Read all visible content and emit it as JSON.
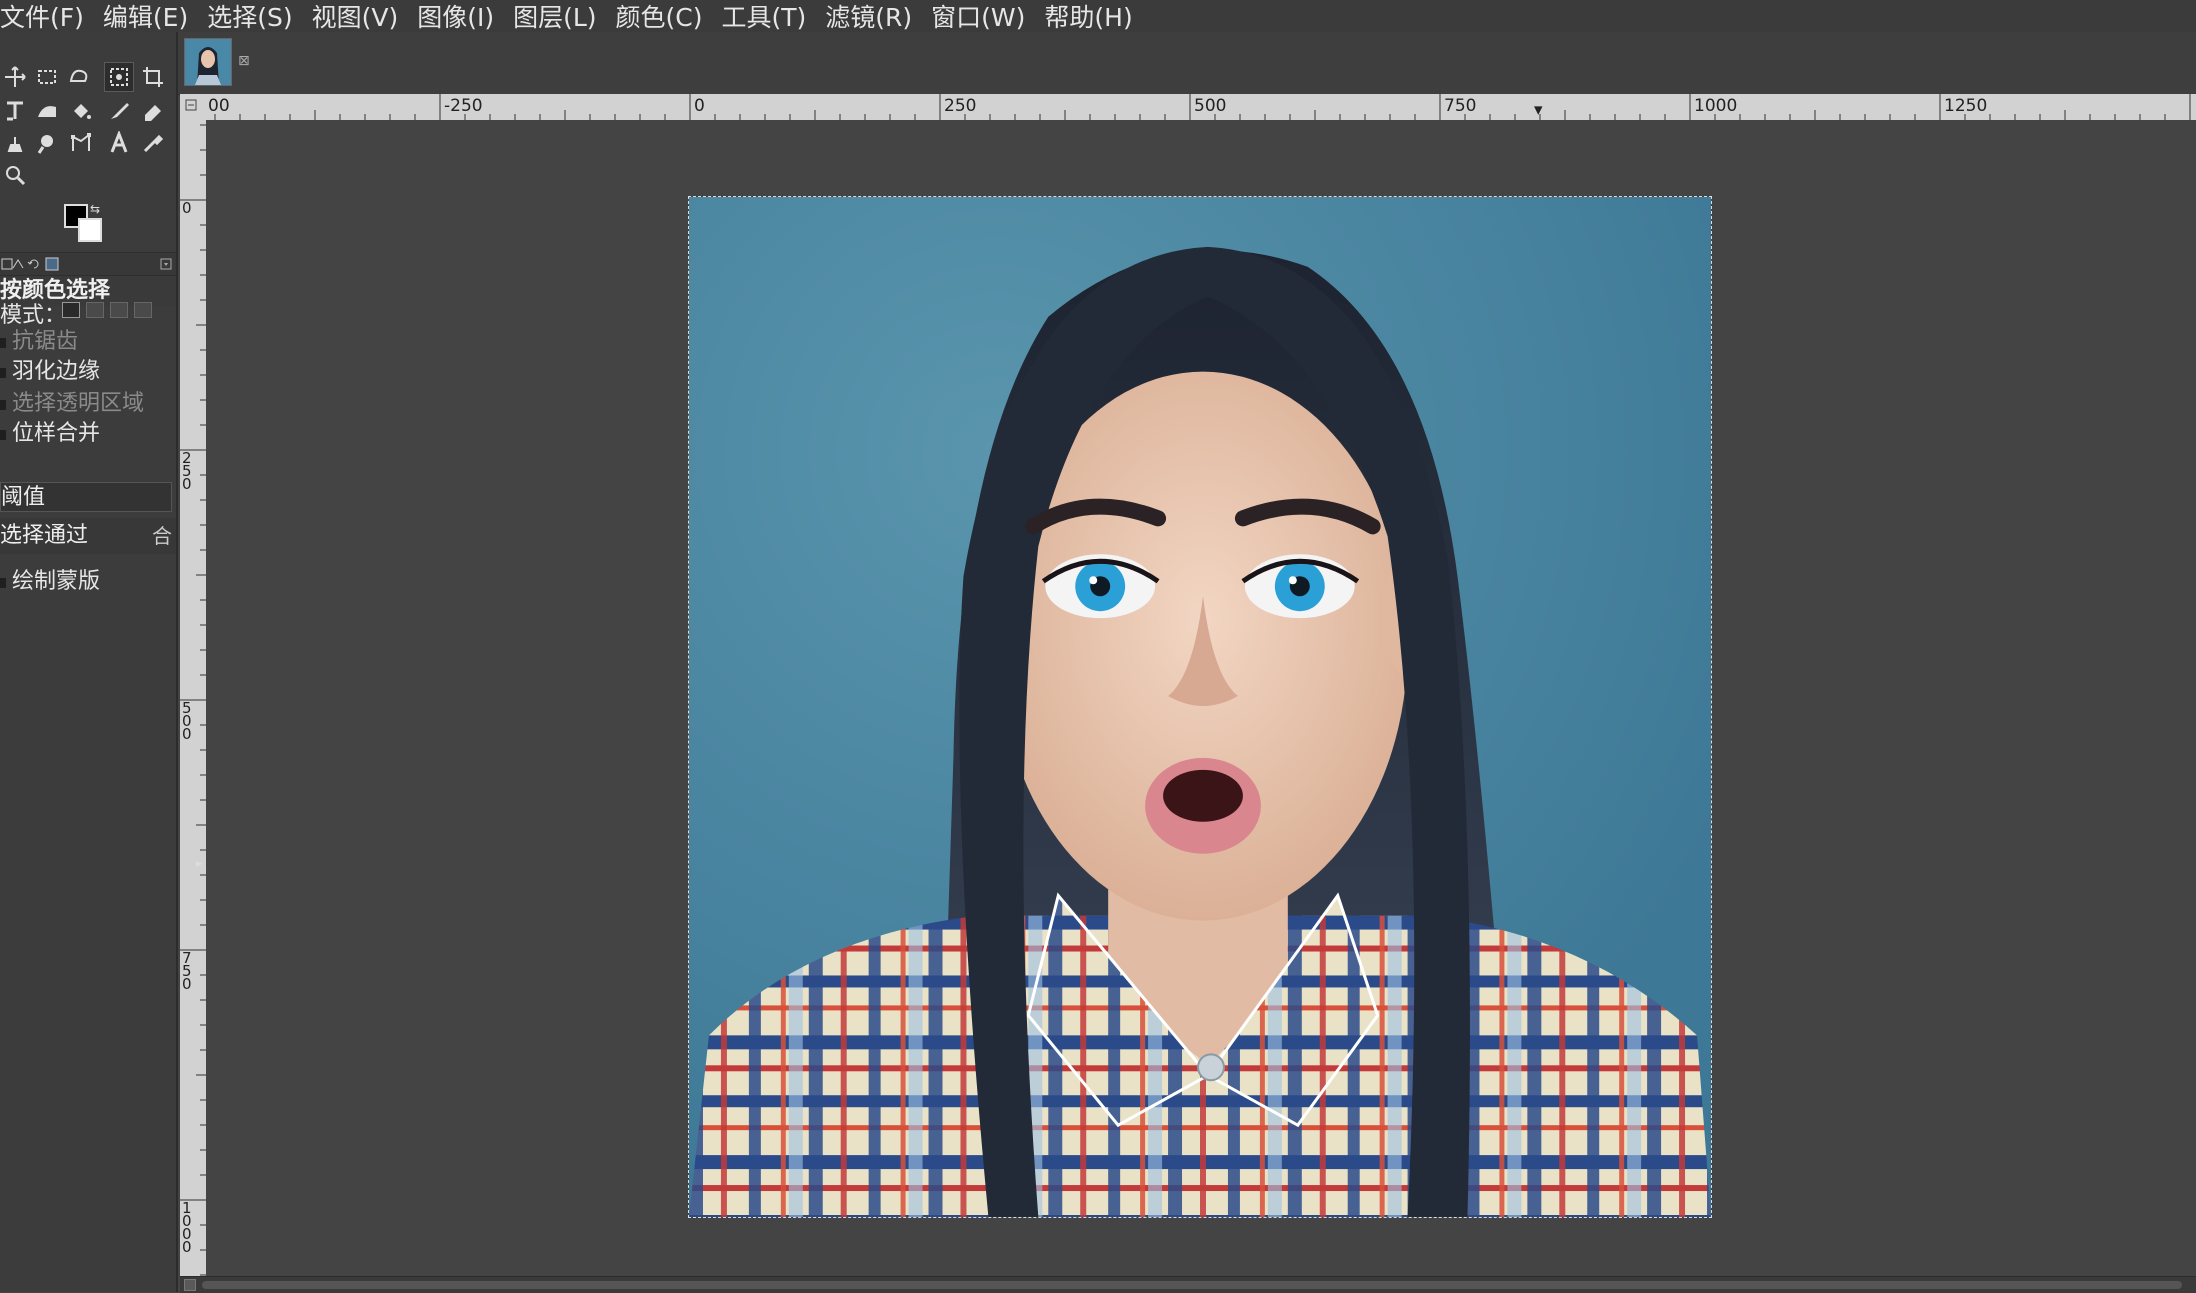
{
  "menubar": {
    "items": [
      "文件(F)",
      "编辑(E)",
      "选择(S)",
      "视图(V)",
      "图像(I)",
      "图层(L)",
      "颜色(C)",
      "工具(T)",
      "滤镜(R)",
      "窗口(W)",
      "帮助(H)"
    ]
  },
  "toolbox": {
    "tools": [
      {
        "name": "move-tool-icon"
      },
      {
        "name": "rect-select-tool-icon"
      },
      {
        "name": "free-select-tool-icon"
      },
      {
        "name": "select-by-color-tool-icon",
        "active": true
      },
      {
        "name": "crop-tool-icon"
      },
      {
        "name": "transform-tool-icon"
      },
      {
        "name": "warp-tool-icon"
      },
      {
        "name": "bucket-fill-tool-icon"
      },
      {
        "name": "paintbrush-tool-icon"
      },
      {
        "name": "eraser-tool-icon"
      },
      {
        "name": "clone-tool-icon"
      },
      {
        "name": "smudge-tool-icon"
      },
      {
        "name": "paths-tool-icon"
      },
      {
        "name": "text-tool-icon"
      },
      {
        "name": "color-picker-tool-icon"
      },
      {
        "name": "zoom-tool-icon"
      }
    ],
    "foreground_color": "#000000",
    "background_color": "#ffffff"
  },
  "tool_options": {
    "title": "按颜色选择",
    "mode_label": "模式：",
    "antialias_label": "抗锯齿",
    "feather_label": "羽化边缘",
    "select_transparent_label": "选择透明区域",
    "sample_merged_label": "位样合并",
    "threshold_label": "阈值",
    "select_by_label": "选择通过",
    "select_by_value_fragment": "合",
    "draw_mask_label": "绘制蒙版"
  },
  "ruler": {
    "top_labels": [
      "00",
      "-250",
      "0",
      "250",
      "500",
      "750",
      "1000",
      "1250"
    ],
    "left_labels": [
      "0",
      "250",
      "500",
      "750",
      "1000"
    ]
  },
  "image": {
    "description_name": "portrait-image"
  }
}
